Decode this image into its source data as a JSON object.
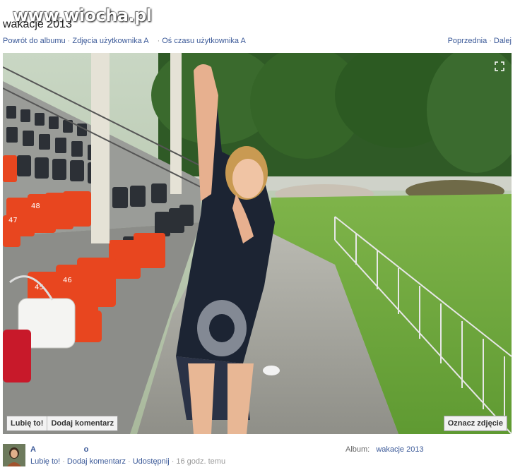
{
  "watermark": "www.wiocha.pl",
  "page_title": "wakacje 2013",
  "nav": {
    "back_to_album": "Powrót do albumu",
    "user_photos": "Zdjęcia użytkownika A",
    "user_timeline": "Oś czasu użytkownika A",
    "previous": "Poprzednia",
    "next": "Dalej"
  },
  "photo_actions": {
    "like": "Lubię to!",
    "comment": "Dodaj komentarz",
    "tag": "Oznacz zdjęcie"
  },
  "footer": {
    "user_name_a": "A",
    "user_name_b": "o",
    "like": "Lubię to!",
    "comment": "Dodaj komentarz",
    "share": "Udostępnij",
    "time": "16 godz. temu",
    "album_label": "Album:",
    "album_name": "wakacje 2013"
  },
  "seat_numbers": [
    "45",
    "46",
    "47",
    "48"
  ],
  "icons": {
    "expand": "expand-icon",
    "avatar": "avatar"
  }
}
